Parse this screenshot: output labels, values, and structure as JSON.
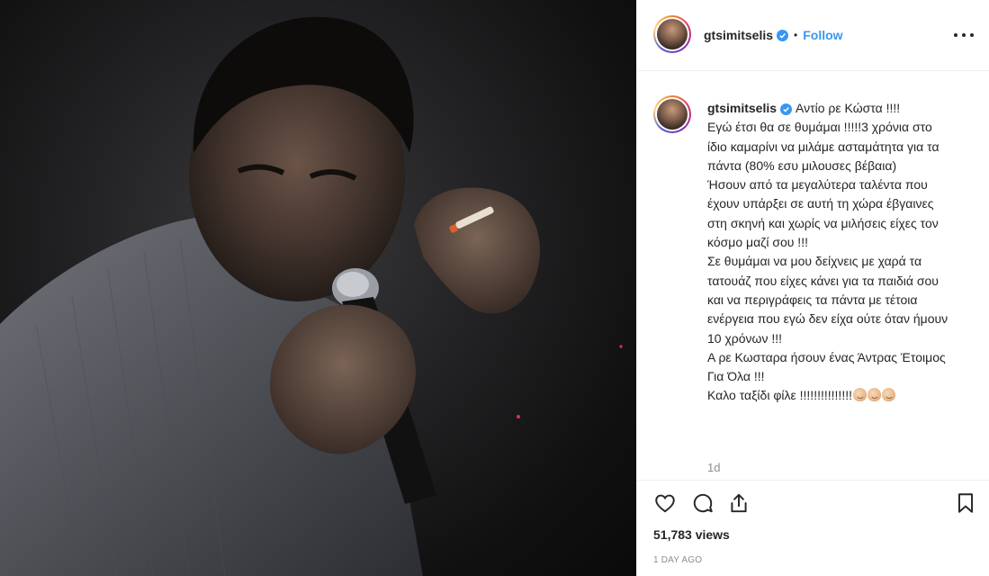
{
  "post": {
    "username": "gtsimitselis",
    "follow_label": "Follow",
    "separator": "•",
    "caption_lines": [
      "Αντίο ρε Κώστα !!!!",
      "Εγώ έτσι θα σε θυμάμαι !!!!!3 χρόνια στο ίδιο καμαρίνι να μιλάμε ασταμάτητα για τα πάντα (80% εσυ μιλουσες βέβαια)",
      "Ήσουν από τα μεγαλύτερα ταλέντα που έχουν υπάρξει σε αυτή τη χώρα έβγαινες στη σκηνή και χωρίς να μιλήσεις είχες τον κόσμο μαζί σου !!!",
      "Σε θυμάμαι να μου δείχνεις με χαρά τα τατουάζ που είχες κάνει για τα παιδιά σου και να περιγράφεις τα πάντα με τέτοια ενέργεια που εγώ δεν είχα ούτε όταν ήμουν 10 χρόνων !!!",
      "Α ρε Κωσταρα ήσουν ένας Άντρας Έτοιμος Για Όλα !!!",
      "Καλο ταξίδι φίλε !!!!!!!!!!!!!!!"
    ],
    "caption_age": "1d",
    "views": "51,783 views",
    "posted_ago": "1 day ago"
  },
  "icons": {
    "verified": "verified-badge-icon",
    "more": "more-options-icon",
    "like": "heart-icon",
    "comment": "comment-icon",
    "share": "share-icon",
    "save": "bookmark-icon",
    "emoji": "flexed-biceps-icon"
  },
  "colors": {
    "accent": "#3897f0",
    "text": "#262626",
    "muted": "#8e8e8e",
    "border": "#efefef"
  }
}
